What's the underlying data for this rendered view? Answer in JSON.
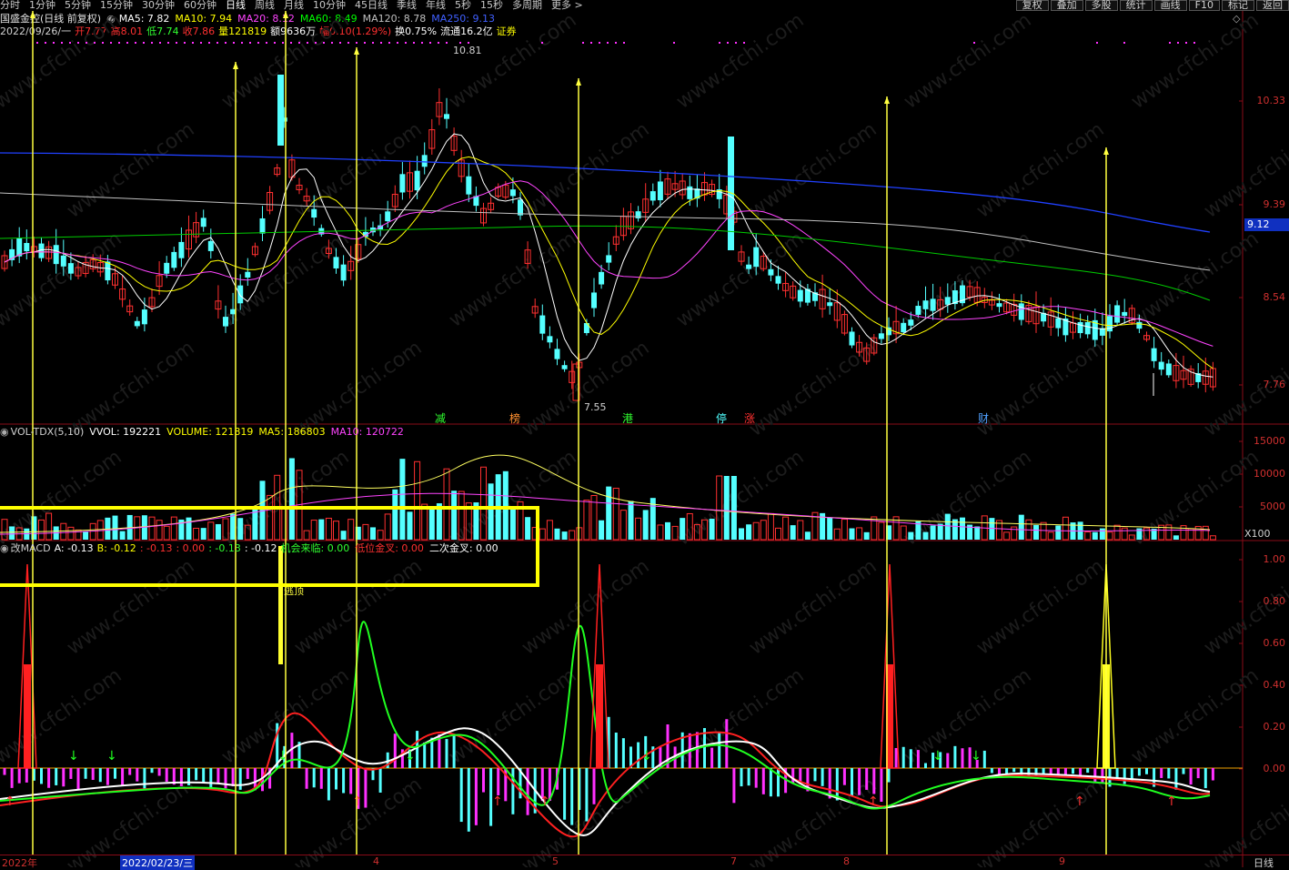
{
  "toolbar": {
    "periods": [
      "分时",
      "1分钟",
      "5分钟",
      "15分钟",
      "30分钟",
      "60分钟",
      "日线",
      "周线",
      "月线",
      "10分钟",
      "45日线",
      "季线",
      "年线",
      "5秒",
      "15秒",
      "多周期",
      "更多 >"
    ],
    "active_period": "日线",
    "right_buttons": [
      "复权",
      "叠加",
      "多股",
      "统计",
      "画线",
      "F10",
      "标记",
      "返回"
    ]
  },
  "main_panel": {
    "title": "国盛金控(日线 前复权)",
    "ma_labels": [
      {
        "text": "MA5: 7.82",
        "color": "#ffffff"
      },
      {
        "text": "MA10: 7.94",
        "color": "#ffff00"
      },
      {
        "text": "MA20: 8.12",
        "color": "#ff44ff"
      },
      {
        "text": "MA60: 8.49",
        "color": "#00ff00"
      },
      {
        "text": "MA120: 8.78",
        "color": "#c0c0c0"
      },
      {
        "text": "MA250: 9.13",
        "color": "#4060ff"
      }
    ],
    "date": "2022/09/26/一",
    "quote": [
      {
        "label": "开",
        "value": "7.77",
        "color": "#ff3030"
      },
      {
        "label": "高",
        "value": "8.01",
        "color": "#ff3030"
      },
      {
        "label": "低",
        "value": "7.74",
        "color": "#30ff30"
      },
      {
        "label": "收",
        "value": "7.86",
        "color": "#ff3030"
      },
      {
        "label": "量",
        "value": "121819",
        "color": "#ffff00"
      },
      {
        "label": "额",
        "value": "9636万",
        "color": "#ffffff"
      },
      {
        "label": "幅",
        "value": "0.10(1.29%)",
        "color": "#ff3030"
      },
      {
        "label": "换",
        "value": "0.75%",
        "color": "#ffffff"
      },
      {
        "label": "流通",
        "value": "16.2亿",
        "color": "#ffffff"
      },
      {
        "label": "",
        "value": "证券",
        "color": "#ffff00"
      }
    ],
    "price_levels": [
      "10.33",
      "9.39",
      "8.54",
      "7.76"
    ],
    "current_price_tag": "9.12",
    "high_marker": "10.81",
    "low_marker": "7.55",
    "event_tags": [
      "减",
      "榜",
      "港",
      "停",
      "涨",
      "财"
    ]
  },
  "volume_panel": {
    "title": "VOL-TDX(5,10)",
    "vvol": "VVOL: 192221",
    "volume": "VOLUME: 121819",
    "ma5": "MA5: 186803",
    "ma10": "MA10: 120722",
    "levels": [
      "15000",
      "10000",
      "5000"
    ],
    "unit": "X100"
  },
  "macd_panel": {
    "title": "改MACD",
    "a": "A: -0.13",
    "b": "B: -0.12",
    "v1": ": -0.13",
    "v2": ": 0.00",
    "v3": ": -0.13",
    "v4": ": -0.12",
    "chance": "机会来临: 0.00",
    "low_cross": "低位金叉: 0.00",
    "second_cross": "二次金叉: 0.00",
    "escape_label": "逃顶",
    "levels": [
      "1.00",
      "0.80",
      "0.60",
      "0.40",
      "0.20",
      "0.00"
    ]
  },
  "x_axis": {
    "year_label": "2022年",
    "cursor_date": "2022/02/23/三",
    "months": [
      "4",
      "5",
      "7",
      "8",
      "9"
    ],
    "period_label": "日线"
  },
  "watermark": "www.cfchi.com",
  "colors": {
    "up": "#ff3030",
    "down": "#54ffff",
    "ma5": "#ffffff",
    "ma10": "#ffff00",
    "ma20": "#ff44ff",
    "ma60": "#00cc00",
    "ma120": "#c0c0c0",
    "ma250": "#2040ff",
    "signal_line": "#ffff40",
    "panel_border": "#8a0b18"
  }
}
